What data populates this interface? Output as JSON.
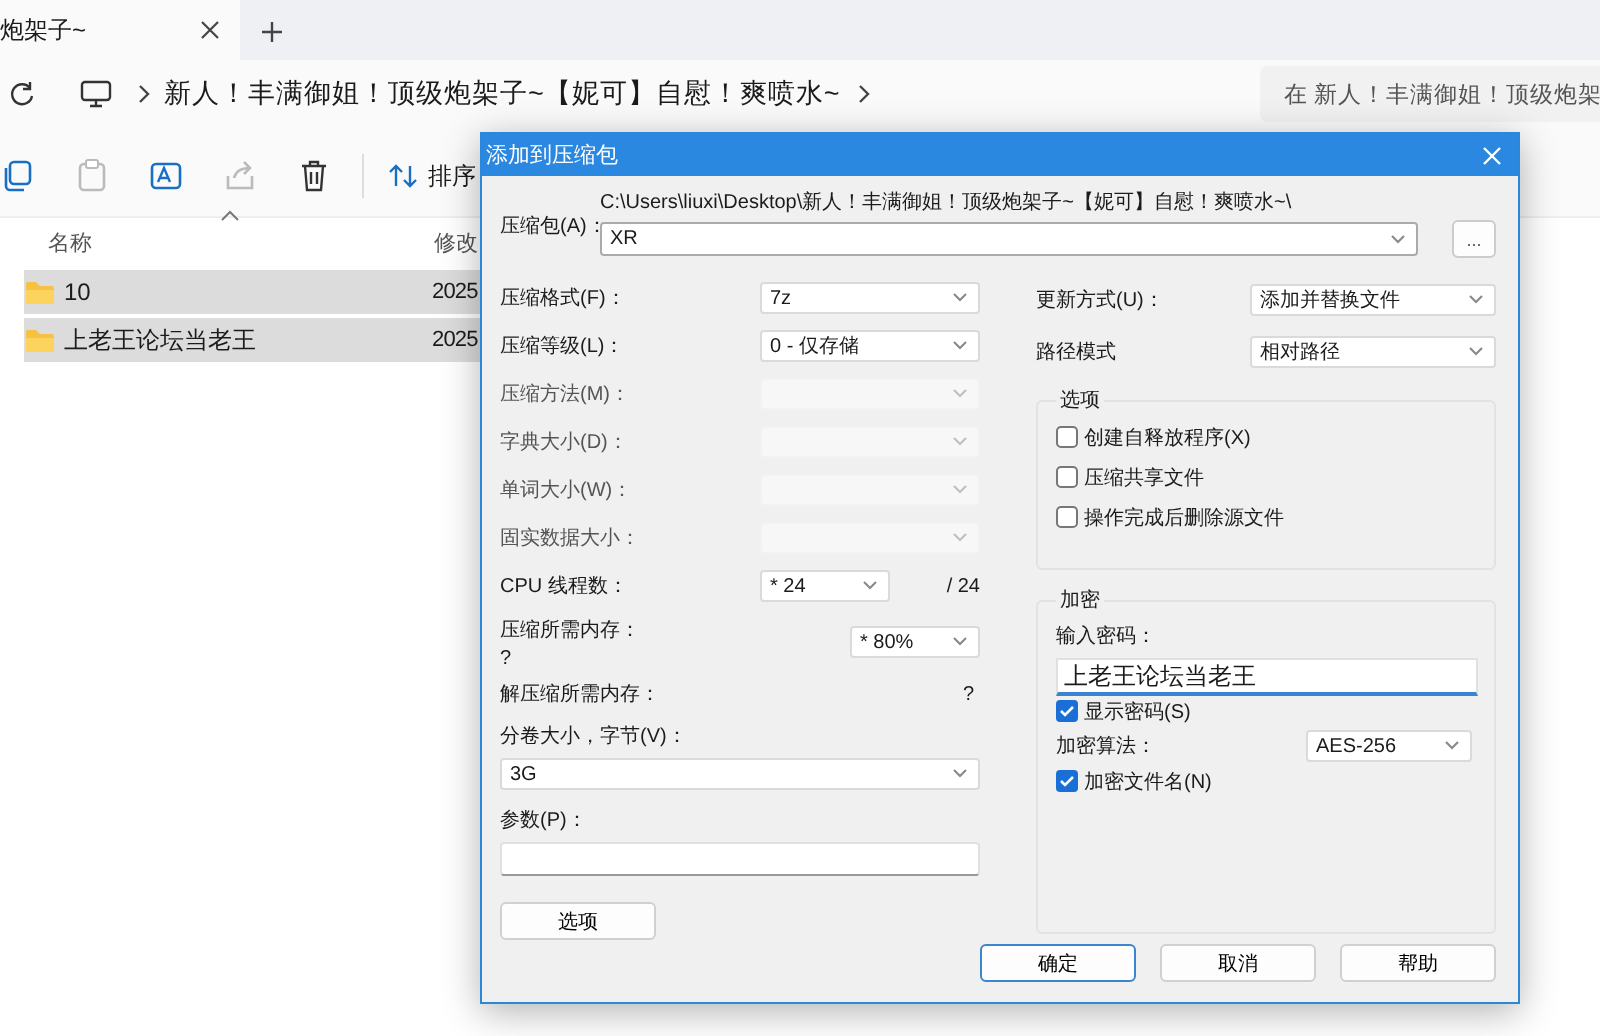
{
  "explorer": {
    "tab": {
      "title": "炮架子~"
    },
    "breadcrumb": "新人！丰满御姐！顶级炮架子~【妮可】自慰！爽喷水~",
    "search": {
      "placeholder": "在 新人！丰满御姐！顶级炮架"
    },
    "sort_label": "排序",
    "columns": [
      "名称",
      "修改"
    ],
    "files": [
      {
        "name": "10",
        "modified": "2025",
        "selected": true
      },
      {
        "name": "上老王论坛当老王",
        "modified": "2025",
        "selected": true
      }
    ]
  },
  "dialog": {
    "title": "添加到压缩包",
    "archive": {
      "label": "压缩包(A)：",
      "path": "C:\\Users\\liuxi\\Desktop\\新人！丰满御姐！顶级炮架子~【妮可】自慰！爽喷水~\\",
      "value": "XR",
      "browse": "..."
    },
    "left": [
      {
        "kind": "combo",
        "label": "压缩格式(F)：",
        "value": "7z",
        "disabled": false
      },
      {
        "kind": "combo",
        "label": "压缩等级(L)：",
        "value": "0 - 仅存储",
        "disabled": false
      },
      {
        "kind": "combo",
        "label": "压缩方法(M)：",
        "disabled": true
      },
      {
        "kind": "combo",
        "label": "字典大小(D)：",
        "disabled": true
      },
      {
        "kind": "combo",
        "label": "单词大小(W)：",
        "disabled": true
      },
      {
        "kind": "combo",
        "label": "固实数据大小：",
        "disabled": true
      },
      {
        "kind": "threads",
        "label": "CPU 线程数：",
        "value": "* 24",
        "total": "/ 24"
      },
      {
        "kind": "memory",
        "label": "压缩所需内存：",
        "note": "?",
        "value": "* 80%"
      },
      {
        "kind": "info",
        "label": "解压缩所需内存：",
        "value": "?"
      },
      {
        "kind": "wide_combo",
        "label": "分卷大小，字节(V)：",
        "value": "3G"
      },
      {
        "kind": "field",
        "label": "参数(P)："
      }
    ],
    "options_button": "选项",
    "right": [
      {
        "label": "更新方式(U)：",
        "value": "添加并替换文件"
      },
      {
        "label": "路径模式",
        "value": "相对路径"
      }
    ],
    "options_group": {
      "title": "选项",
      "items": [
        {
          "label": "创建自释放程序(X)",
          "checked": false
        },
        {
          "label": "压缩共享文件",
          "checked": false
        },
        {
          "label": "操作完成后删除源文件",
          "checked": false
        }
      ]
    },
    "encryption": {
      "title": "加密",
      "password_label": "输入密码：",
      "password": "上老王论坛当老王",
      "show_password": {
        "label": "显示密码(S)",
        "checked": true
      },
      "method_label": "加密算法：",
      "method": "AES-256",
      "encrypt_names": {
        "label": "加密文件名(N)",
        "checked": true
      }
    },
    "buttons": [
      {
        "label": "确定",
        "default": true
      },
      {
        "label": "取消",
        "default": false
      },
      {
        "label": "帮助",
        "default": false
      }
    ]
  }
}
